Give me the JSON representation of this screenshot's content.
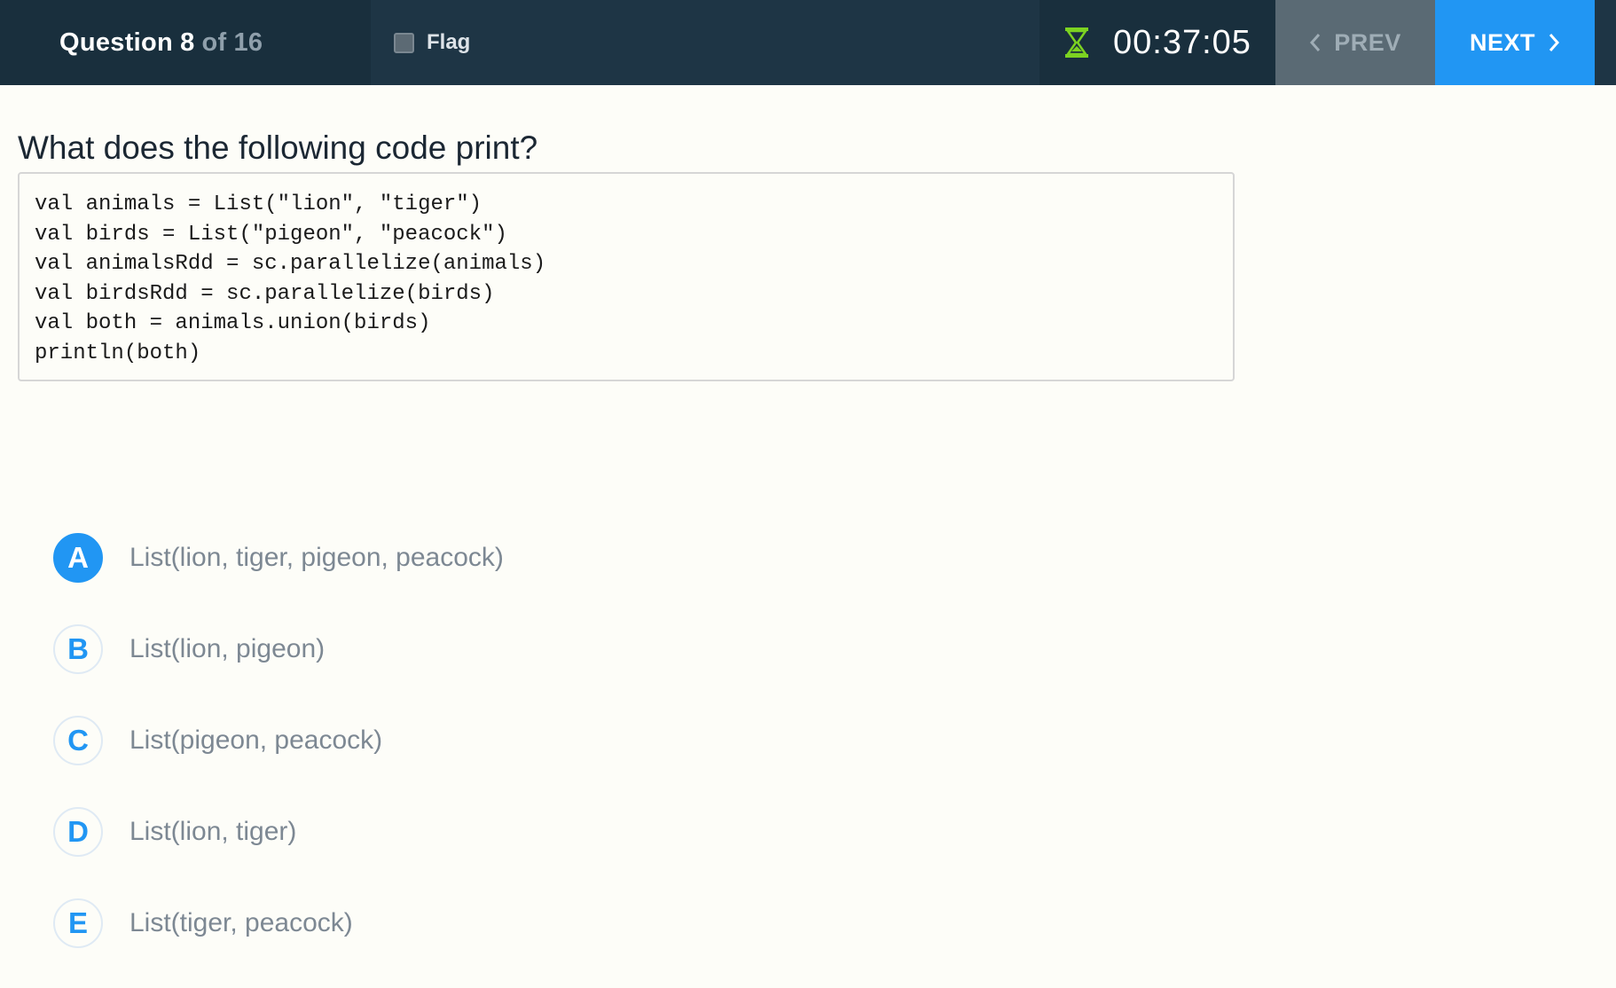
{
  "header": {
    "question_word": "Question",
    "question_number": "8",
    "of_word": "of",
    "total": "16",
    "flag_label": "Flag",
    "timer": "00:37:05",
    "prev_label": "PREV",
    "next_label": "NEXT"
  },
  "question": {
    "title": "What does the following code print?",
    "code_lines": [
      "val animals = List(\"lion\", \"tiger\")",
      "val birds = List(\"pigeon\", \"peacock\")",
      "val animalsRdd = sc.parallelize(animals)",
      "val birdsRdd = sc.parallelize(birds)",
      "val both = animals.union(birds)",
      "println(both)"
    ]
  },
  "options": [
    {
      "letter": "A",
      "text": "List(lion, tiger, pigeon, peacock)",
      "selected": true
    },
    {
      "letter": "B",
      "text": "List(lion, pigeon)",
      "selected": false
    },
    {
      "letter": "C",
      "text": "List(pigeon, peacock)",
      "selected": false
    },
    {
      "letter": "D",
      "text": "List(lion, tiger)",
      "selected": false
    },
    {
      "letter": "E",
      "text": "List(tiger, peacock)",
      "selected": false
    }
  ],
  "colors": {
    "accent": "#2196f3",
    "topbar": "#1e3545",
    "timer_icon": "#7cd321"
  }
}
